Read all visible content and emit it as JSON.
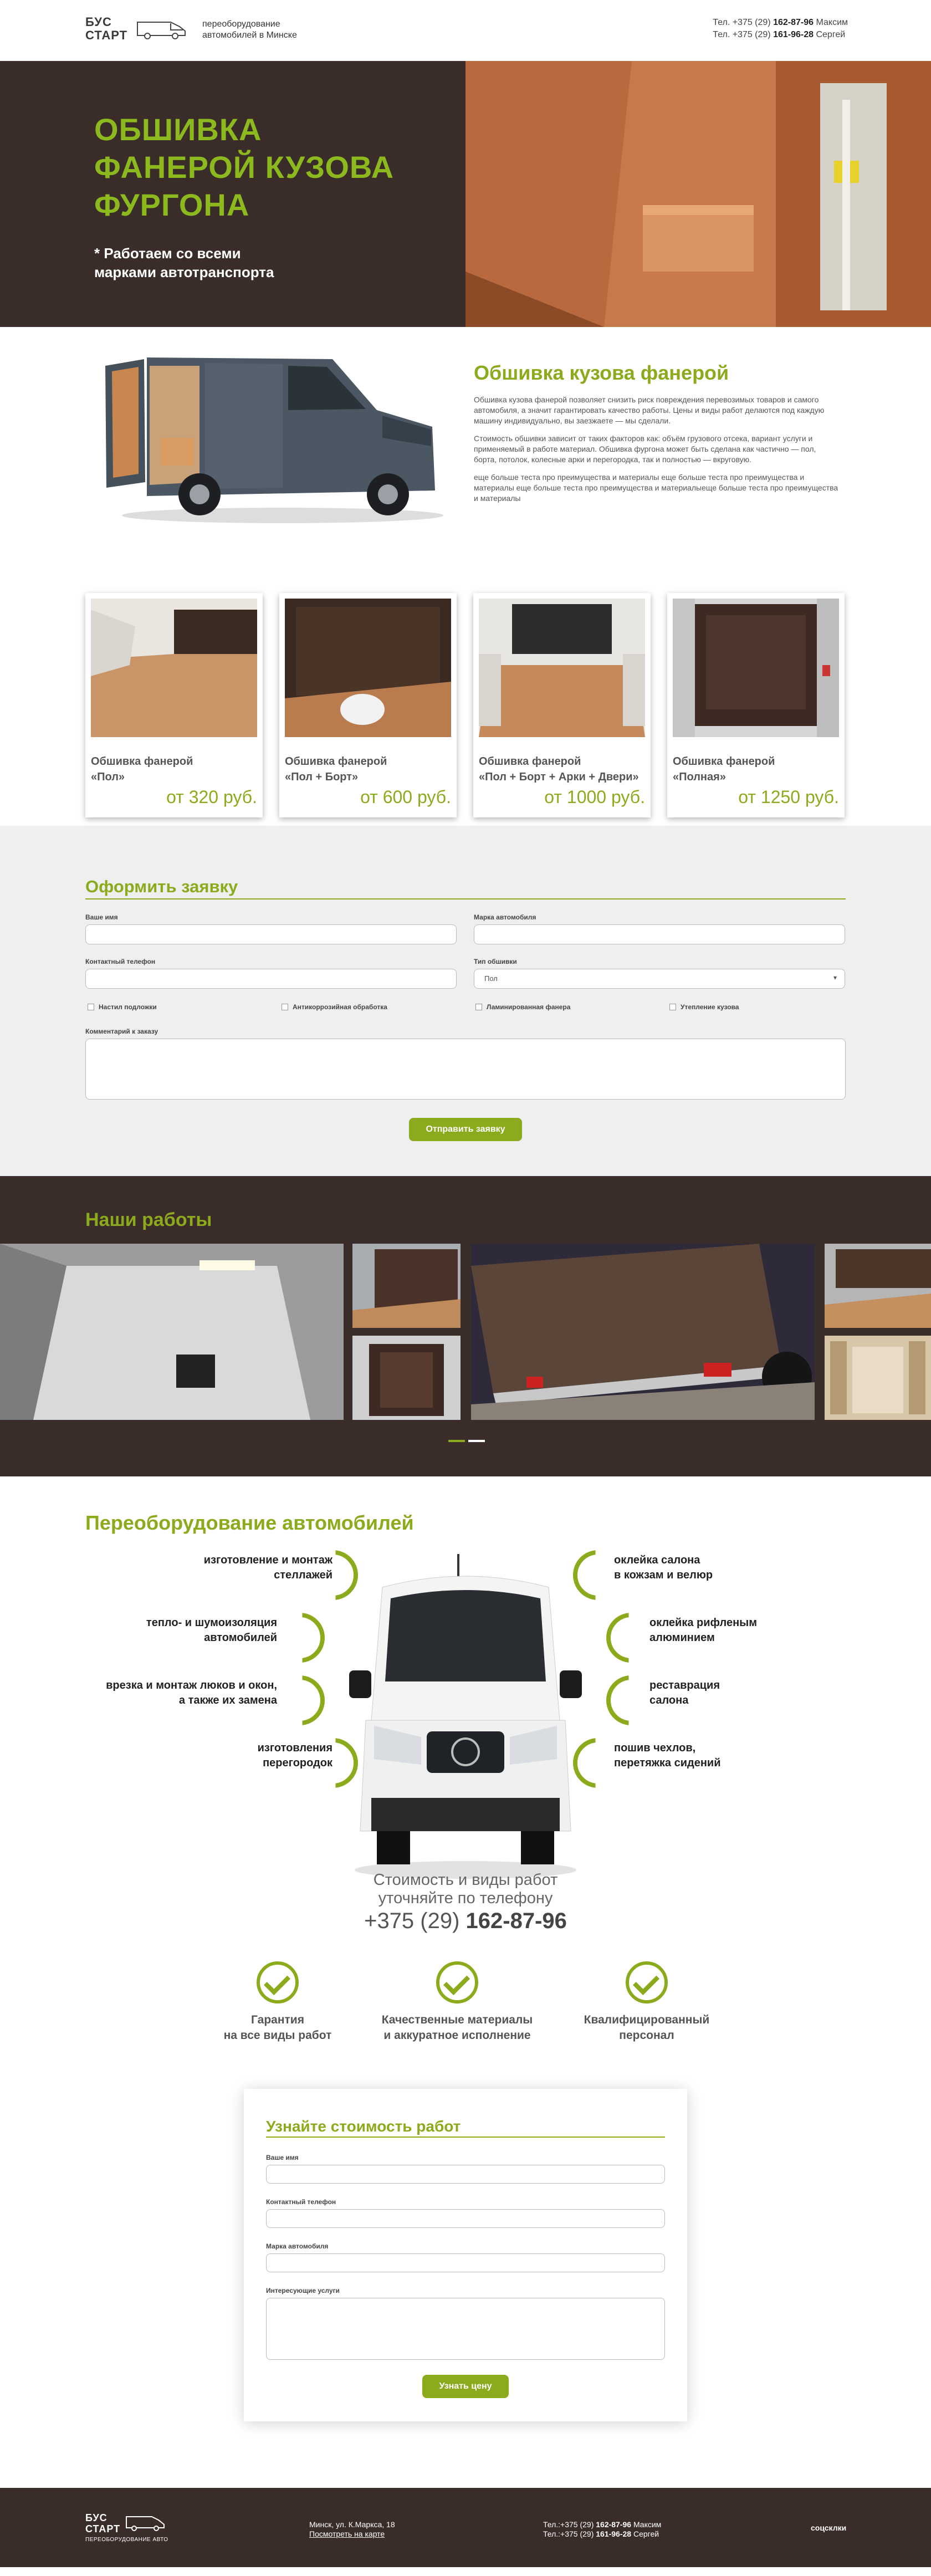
{
  "header": {
    "logo_line1": "БУС",
    "logo_line2": "СТАРТ",
    "tagline": "переоборудование автомобилей в Минске",
    "phone1_prefix": "Тел. +375 (29) ",
    "phone1_number": "162-87-96",
    "phone1_name": " Максим",
    "phone2_prefix": "Тел. +375 (29) ",
    "phone2_number": "161-96-28",
    "phone2_name": " Сергей"
  },
  "hero": {
    "title_line1": "ОБШИВКА",
    "title_line2": "ФАНЕРОЙ КУЗОВА",
    "title_line3": "ФУРГОНА",
    "subtitle_line1": "* Работаем со всеми",
    "subtitle_line2": "марками автотранспорта"
  },
  "about": {
    "title": "Обшивка кузова фанерой",
    "p1": "Обшивка кузова фанерой позволяет снизить риск повреждения перевозимых товаров и самого автомобиля, а значит гарантировать качество работы. Цены и виды работ делаются под каждую машину индивидуально, вы заезжаете — мы сделали.",
    "p2": "Стоимость обшивки зависит от таких факторов как: объём грузового отсека, вариант услуги и применяемый в работе материал. Обшивка фургона может быть сделана как частично — пол, борта, потолок, колесные арки и перегородка, так и полностью — вкруговую.",
    "p3": "еще больше теста про преимущества и материалы еще больше теста про преимущества и материалы еще больше теста про преимущества и материалыеще больше теста про преимущества и материалы"
  },
  "cards": [
    {
      "name1": "Обшивка фанерой",
      "name2": "«Пол»",
      "price": "от 320 руб."
    },
    {
      "name1": "Обшивка фанерой",
      "name2": "«Пол + Борт»",
      "price": "от 600 руб."
    },
    {
      "name1": "Обшивка фанерой",
      "name2": "«Пол + Борт + Арки + Двери»",
      "price": "от 1000 руб."
    },
    {
      "name1": "Обшивка фанерой",
      "name2": "«Полная»",
      "price": "от 1250 руб."
    }
  ],
  "order": {
    "title": "Оформить заявку",
    "name_label": "Ваше имя",
    "car_label": "Марка автомобиля",
    "phone_label": "Контактный телефон",
    "type_label": "Тип обшивки",
    "type_value": "Пол",
    "opt1": "Настил подложки",
    "opt2": "Антикоррозийная обработка",
    "opt3": "Ламинированная фанера",
    "opt4": "Утепление кузова",
    "comment_label": "Комментарий к заказу",
    "submit": "Отправить заявку"
  },
  "works": {
    "title": "Наши работы"
  },
  "conversion": {
    "title": "Переоборудование автомобилей",
    "l1a": "изготовление и монтаж",
    "l1b": "стеллажей",
    "l2a": "тепло- и шумоизоляция",
    "l2b": "автомобилей",
    "l3a": "врезка и монтаж люков и окон,",
    "l3b": "а также их замена",
    "l4a": "изготовления",
    "l4b": "перегородок",
    "r1a": "оклейка салона",
    "r1b": "в кожзам и велюр",
    "r2a": "оклейка рифленым",
    "r2b": "алюминием",
    "r3a": "реставрация",
    "r3b": "салона",
    "r4a": "пошив чехлов,",
    "r4b": "перетяжка сидений",
    "price_line1": "Стоимость и виды работ",
    "price_line2": "уточняйте по телефону",
    "phone_prefix": "+375 (29) ",
    "phone_number": "162-87-96",
    "adv": [
      {
        "a": "Гарантия",
        "b": "на все виды работ"
      },
      {
        "a": "Качественные материалы",
        "b": "и аккуратное исполнение"
      },
      {
        "a": "Квалифицированный",
        "b": "персонал"
      }
    ]
  },
  "cost": {
    "title": "Узнайте стоимость работ",
    "name_label": "Ваше имя",
    "phone_label": "Контактный телефон",
    "car_label": "Марка автомобиля",
    "service_label": "Интересующие услуги",
    "submit": "Узнать цену"
  },
  "footer": {
    "logo_line1": "БУС",
    "logo_line2": "СТАРТ",
    "sub": "ПЕРЕОБОРУДОВАНИЕ АВТО",
    "address": "Минск, ул. К.Маркса, 18",
    "map_link": "Посмотреть на карте",
    "phone1_prefix": "Тел.:+375 (29) ",
    "phone1_number": "162-87-96",
    "phone1_name": " Максим",
    "phone2_prefix": "Тел.:+375 (29) ",
    "phone2_number": "161-96-28",
    "phone2_name": " Сергей",
    "social": "соцсклки"
  },
  "colors": {
    "accent": "#8cab1c",
    "dark": "#3a2c29",
    "form_bg": "#efefef"
  }
}
